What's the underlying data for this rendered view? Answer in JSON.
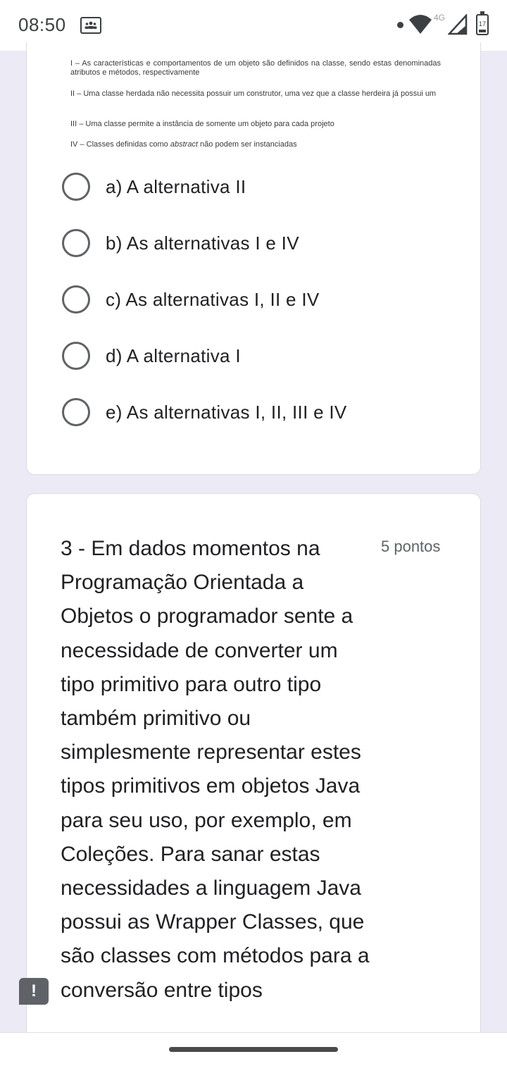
{
  "status_bar": {
    "time": "08:50",
    "network_label": "4G",
    "battery_level": "17",
    "icons": [
      "notification-icon",
      "dot-icon",
      "wifi-icon",
      "signal-icon",
      "battery-icon"
    ]
  },
  "question2": {
    "statements": [
      {
        "text": "I – As características e comportamentos de um objeto são definidos na classe, sendo estas denominadas atributos e métodos, respectivamente"
      },
      {
        "text": "II – Uma classe herdada não necessita possuir um construtor, uma vez que a classe herdeira já possui um"
      },
      {
        "text": "III – Uma classe permite a instância de somente um objeto para cada projeto"
      },
      {
        "prefix": "IV – Classes definidas como ",
        "emphasis": "abstract",
        "suffix": " não podem ser instanciadas"
      }
    ],
    "options": [
      {
        "label": "a) A alternativa II",
        "selected": false
      },
      {
        "label": "b) As alternativas I e IV",
        "selected": false
      },
      {
        "label": "c) As alternativas I, II e IV",
        "selected": false
      },
      {
        "label": "d) A alternativa I",
        "selected": false
      },
      {
        "label": "e) As alternativas I, II, III e IV",
        "selected": false
      }
    ]
  },
  "question3": {
    "text": "3 - Em dados momentos na Programação Orientada a Objetos o programador sente a necessidade de converter um tipo primitivo para outro tipo também primitivo ou simplesmente representar estes tipos primitivos em objetos Java para seu uso, por exemplo, em Coleções. Para sanar estas necessidades a linguagem Java possui as Wrapper Classes, que são classes com métodos para a conversão entre tipos",
    "points": "5 pontos"
  },
  "alert": {
    "symbol": "!"
  },
  "colors": {
    "background": "#ecebf5",
    "card": "#ffffff",
    "radio_border": "#5f6368"
  }
}
